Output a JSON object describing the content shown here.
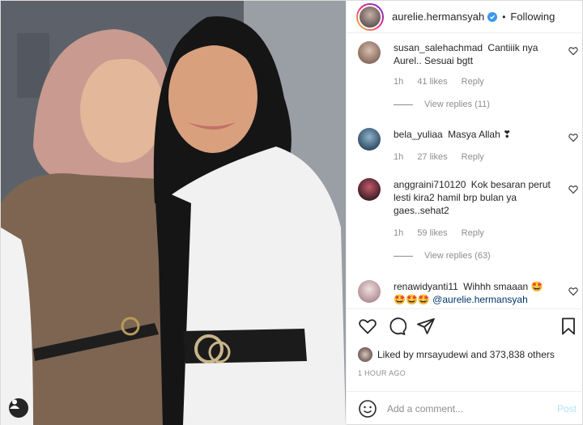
{
  "post": {
    "username": "aurelie.hermansyah",
    "separator": "•",
    "follow_status": "Following"
  },
  "comments": [
    {
      "username": "susan_salehachmad",
      "text": "Cantiiik nya Aurel.. Sesuai bgtt",
      "time": "1h",
      "likes": "41 likes",
      "reply": "Reply",
      "view_replies": "View replies (11)"
    },
    {
      "username": "bela_yuliaa",
      "text": "Masya Allah ❣",
      "time": "1h",
      "likes": "27 likes",
      "reply": "Reply"
    },
    {
      "username": "anggraini710120",
      "text": "Kok besaran perut lesti kira2 hamil brp bulan ya gaes..sehat2",
      "time": "1h",
      "likes": "59 likes",
      "reply": "Reply",
      "view_replies": "View replies (63)"
    },
    {
      "username": "renawidyanti11",
      "text": "Wihhh smaaan 🤩",
      "text2": "🤩🤩🤩",
      "mention": "@aurelie.hermansyah"
    }
  ],
  "likes": {
    "prefix": "Liked by",
    "user": "mrsayudewi",
    "middle": "and",
    "count": "373,838 others"
  },
  "timestamp": "1 HOUR AGO",
  "add_comment": {
    "placeholder": "Add a comment...",
    "post_label": "Post"
  },
  "icons": {
    "header_verified": "verified-badge-icon",
    "heart": "heart-icon",
    "comment": "comment-icon",
    "share": "share-icon",
    "save": "bookmark-icon",
    "emoji": "emoji-icon",
    "tag": "user-tag-icon"
  },
  "colors": {
    "verified": "#3897f0",
    "muted": "#8e8e8e",
    "post_disabled": "#b2dffc",
    "mention": "#00376b"
  }
}
